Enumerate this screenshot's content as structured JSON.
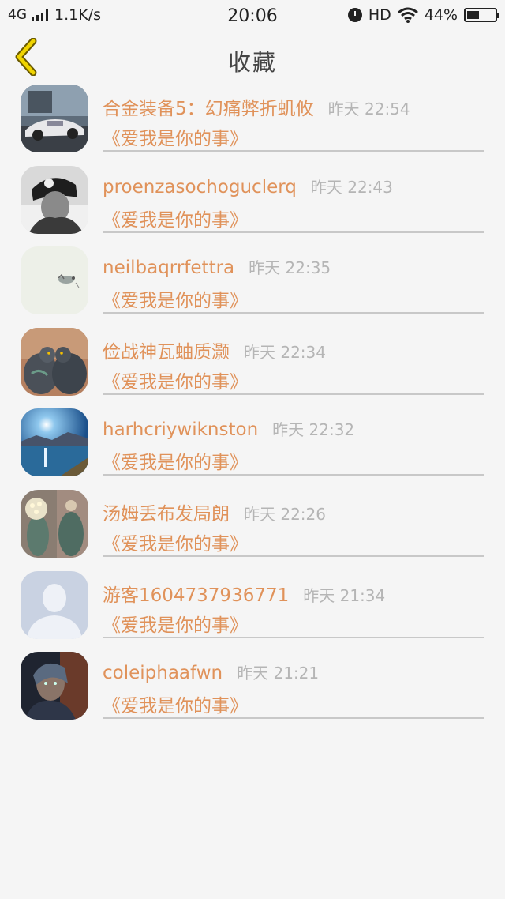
{
  "status_bar": {
    "network": "4G",
    "speed": "1.1K/s",
    "time": "20:06",
    "hd": "HD",
    "battery": "44%",
    "battery_level": 0.44
  },
  "header": {
    "title": "收藏",
    "accent": "#e6c800"
  },
  "colors": {
    "name": "#e0925a",
    "time": "#b5b5b5",
    "divider": "#c8c8c8"
  },
  "items": [
    {
      "name": "合金装备5：幻痛弊折虮攸",
      "time": "昨天 22:54",
      "book": "《爱我是你的事》",
      "avatar": "car"
    },
    {
      "name": "proenzasochoguclerq",
      "time": "昨天 22:43",
      "book": "《爱我是你的事》",
      "avatar": "person-bw"
    },
    {
      "name": "neilbaqrrfettra",
      "time": "昨天 22:35",
      "book": "《爱我是你的事》",
      "avatar": "sketch"
    },
    {
      "name": "俭战神瓦蚰质灏",
      "time": "昨天 22:34",
      "book": "《爱我是你的事》",
      "avatar": "birds"
    },
    {
      "name": "harhcriywiknston",
      "time": "昨天 22:32",
      "book": "《爱我是你的事》",
      "avatar": "lake"
    },
    {
      "name": "汤姆丢布发局朗",
      "time": "昨天 22:26",
      "book": "《爱我是你的事》",
      "avatar": "cactus"
    },
    {
      "name": "游客1604737936771",
      "time": "昨天 21:34",
      "book": "《爱我是你的事》",
      "avatar": "default-user"
    },
    {
      "name": "coleiphaafwn",
      "time": "昨天 21:21",
      "book": "《爱我是你的事》",
      "avatar": "game-character"
    }
  ]
}
